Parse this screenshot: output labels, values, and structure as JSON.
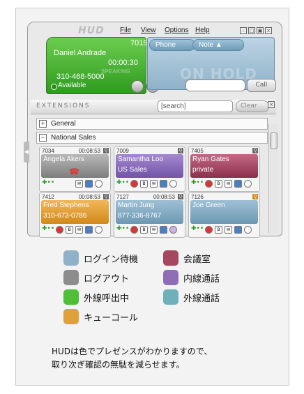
{
  "app": {
    "logo": "HUD",
    "menu": [
      "File",
      "View",
      "Options",
      "Help"
    ]
  },
  "user_panel": {
    "extension": "7015",
    "name": "Daniel Andrade",
    "timer": "00:00:30",
    "phone": "310-468-5000",
    "status": "Available",
    "watermark": "SPEAKING"
  },
  "call_panel": {
    "tabs": [
      "Phone",
      "Note"
    ],
    "big_label": "ON HOLD",
    "call_button": "Call"
  },
  "extensions": {
    "title": "EXTENSIONS",
    "search_value": "[search]",
    "clear_button": "Clear",
    "groups": [
      {
        "sign": "+",
        "label": "General"
      },
      {
        "sign": "−",
        "label": "National Sales"
      }
    ]
  },
  "cards": [
    {
      "ext": "7034",
      "time": "00:08:53",
      "line1": "Angela Akers",
      "line2": "",
      "state": "gray"
    },
    {
      "ext": "7009",
      "time": "",
      "line1": "Samantha Loo",
      "line2": "US Sales",
      "state": "purple"
    },
    {
      "ext": "7405",
      "time": "",
      "line1": "Ryan Gates",
      "line2": "private",
      "state": "conference"
    },
    {
      "ext": "7412",
      "time": "00:08:53",
      "line1": "Fred Stephens",
      "line2": "310-673-0786",
      "state": "queue"
    },
    {
      "ext": "7127",
      "time": "00:08:53",
      "line1": "Martin Jung",
      "line2": "877-336-8767",
      "state": "blue"
    },
    {
      "ext": "7126",
      "time": "",
      "line1": "Joe Green",
      "line2": "",
      "state": "blue"
    }
  ],
  "legend": {
    "left": [
      {
        "label": "ログイン待機",
        "color": "#8fb2c9"
      },
      {
        "label": "ログアウト",
        "color": "#8d8d8d"
      },
      {
        "label": "外線呼出中",
        "color": "#4ebf37"
      },
      {
        "label": "キューコール",
        "color": "#e0a238"
      }
    ],
    "right": [
      {
        "label": "会議室",
        "color": "#a64760"
      },
      {
        "label": "内線通話",
        "color": "#8e6fb5"
      },
      {
        "label": "外線通話",
        "color": "#6fb1bb"
      }
    ]
  },
  "note": {
    "line1": "HUDは色でプレゼンスがわかりますので、",
    "line2": "取り次ぎ確認の無駄を減らせます。"
  }
}
